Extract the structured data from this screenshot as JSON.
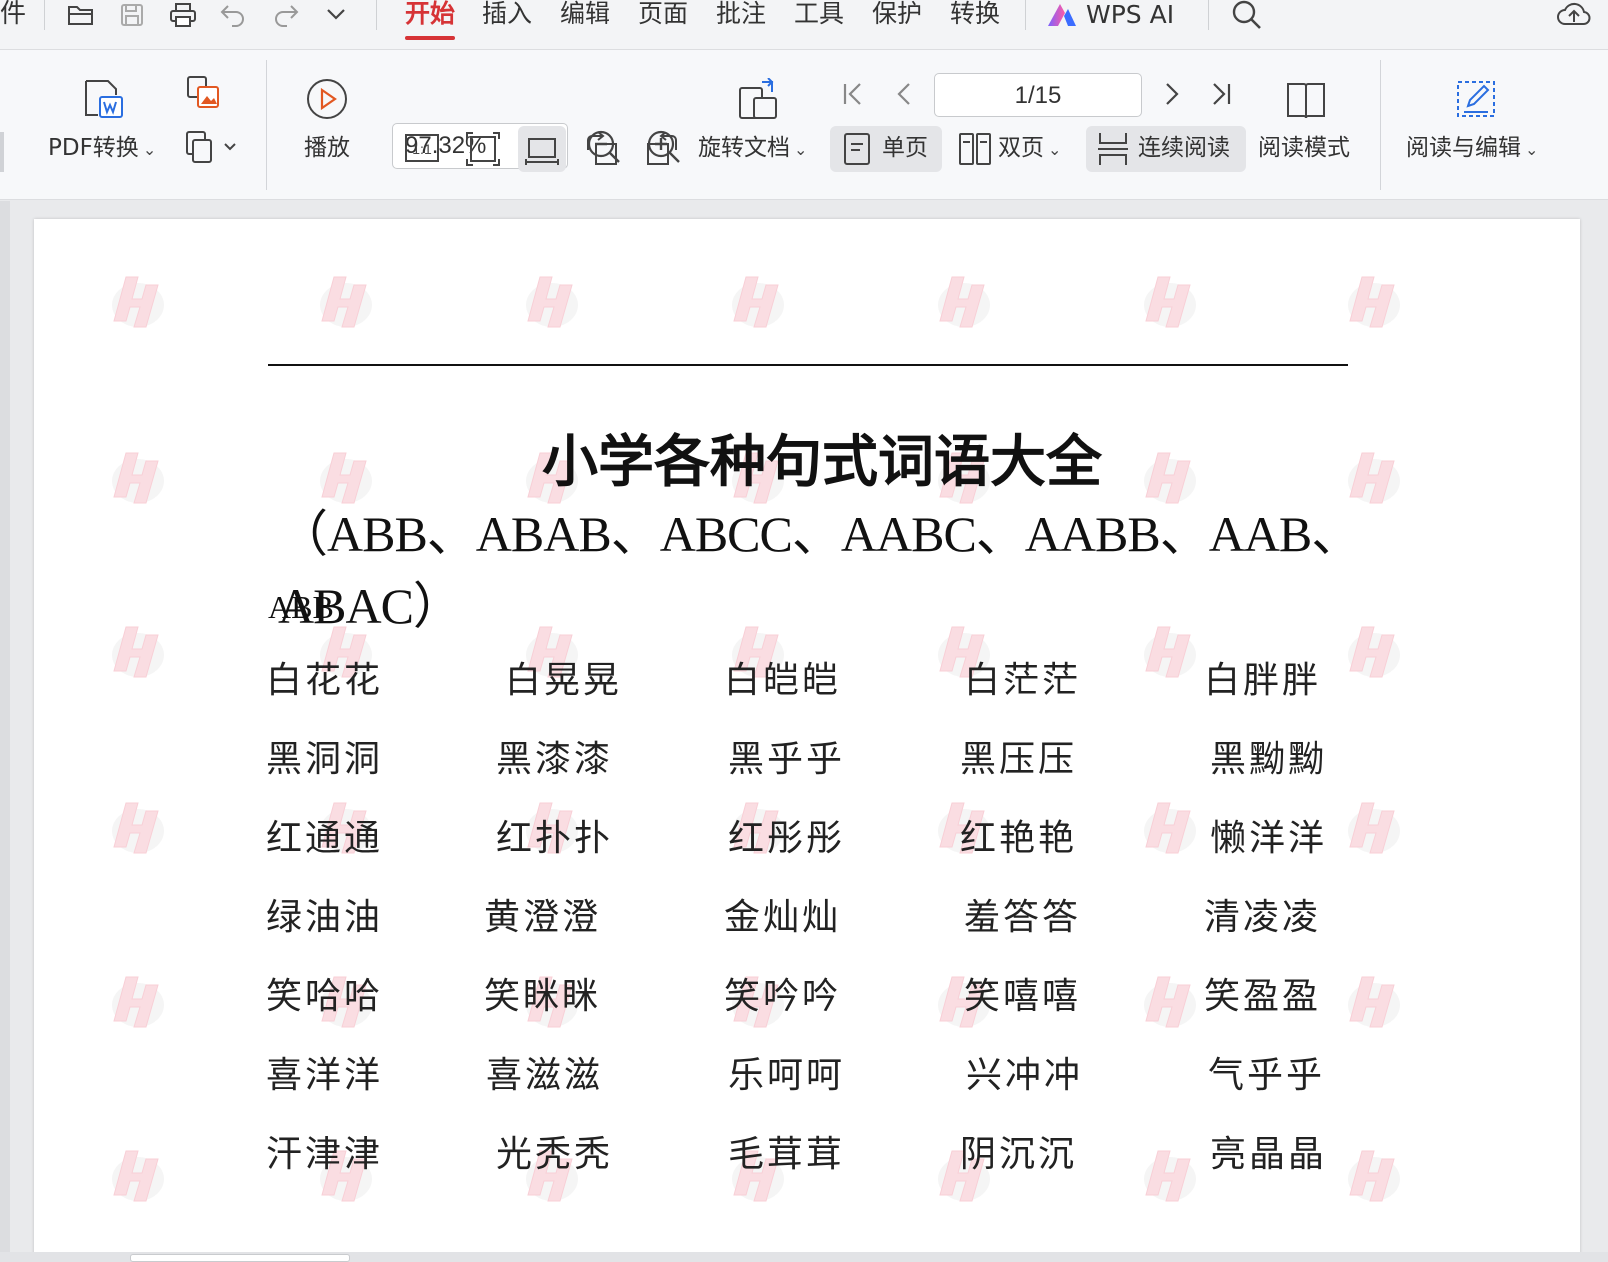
{
  "menubar": {
    "partial_label": "件",
    "tabs": [
      "开始",
      "插入",
      "编辑",
      "页面",
      "批注",
      "工具",
      "保护",
      "转换"
    ],
    "ai_label": "WPS AI",
    "icons": [
      "open-folder-icon",
      "save-icon",
      "print-icon",
      "undo-icon",
      "redo-icon",
      "more-chevron-icon",
      "search-icon",
      "cloud-upload-icon"
    ],
    "colors": {
      "active_tab": "#d63336",
      "ai_gradient": [
        "#7b61ff",
        "#ff5aa5"
      ]
    }
  },
  "ribbon": {
    "pdf_convert_label": "PDF转换",
    "play_label": "播放",
    "zoom_value": "97.32%",
    "rotate_label": "旋转文档",
    "single_page_label": "单页",
    "double_page_label": "双页",
    "continuous_label": "连续阅读",
    "reading_mode_label": "阅读模式",
    "read_edit_label": "阅读与编辑",
    "page_indicator": "1/15"
  },
  "document": {
    "title": "小学各种句式词语大全",
    "subtitle": "（ABB、ABAB、ABCC、AABC、AABB、AAB、ABAC）",
    "section": "ABB",
    "rows": [
      [
        "白花花",
        "白晃晃",
        "白皑皑",
        "白茫茫",
        "白胖胖"
      ],
      [
        "黑洞洞",
        "黑漆漆",
        "黑乎乎",
        "黑压压",
        "黑黝黝"
      ],
      [
        "红通通",
        "红扑扑",
        "红彤彤",
        "红艳艳",
        "懒洋洋"
      ],
      [
        "绿油油",
        "黄澄澄",
        "金灿灿",
        "羞答答",
        "清凌凌"
      ],
      [
        "笑哈哈",
        "笑眯眯",
        "笑吟吟",
        "笑嘻嘻",
        "笑盈盈"
      ],
      [
        "喜洋洋",
        "喜滋滋",
        "乐呵呵",
        "兴冲冲",
        "气乎乎"
      ],
      [
        "汗津津",
        "光秃秃",
        "毛茸茸",
        "阴沉沉",
        "亮晶晶"
      ]
    ]
  }
}
